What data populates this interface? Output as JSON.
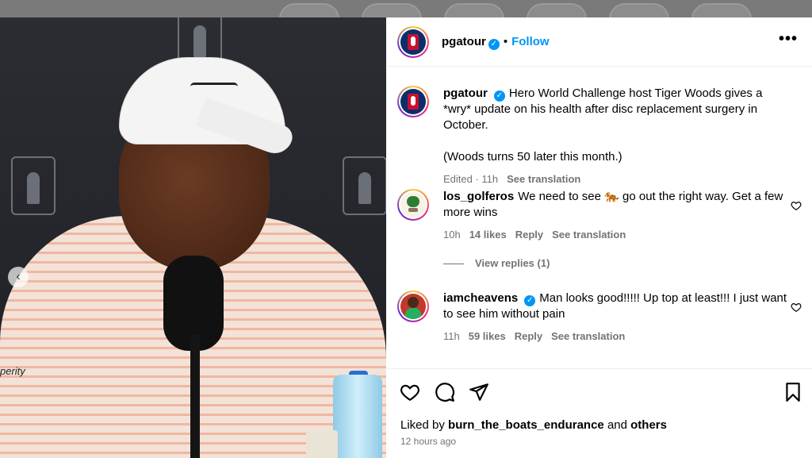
{
  "post": {
    "username": "pgatour",
    "follow_label": "Follow",
    "dot": "•",
    "more_label": "•••"
  },
  "photo": {
    "side_text": "perity",
    "carousel_prev": "‹"
  },
  "caption": {
    "username": "pgatour",
    "text_line1": "Hero World Challenge host Tiger Woods gives a *wry* update on his health after disc replacement surgery in October.",
    "text_line2": "(Woods turns 50 later this month.)",
    "edited": "Edited · 11h",
    "see_translation": "See translation"
  },
  "comments": [
    {
      "username": "los_golferos",
      "text": "We need to see 🐅 go out the right way. Get a few more wins",
      "time": "10h",
      "likes": "14 likes",
      "reply": "Reply",
      "see_translation": "See translation",
      "view_replies": "View replies (1)"
    },
    {
      "username": "iamcheavens",
      "text": "Man looks good!!!!! Up top at least!!! I just want to see him without pain",
      "time": "11h",
      "likes": "59 likes",
      "reply": "Reply",
      "see_translation": "See translation"
    }
  ],
  "footer": {
    "liked_by_prefix": "Liked by",
    "liked_by_user": "burn_the_boats_endurance",
    "liked_by_and": "and",
    "liked_by_others": "others",
    "time_ago": "12 hours ago"
  },
  "icons": {
    "verified": "verified-badge-icon",
    "heart": "heart-icon",
    "comment": "comment-icon",
    "share": "share-icon",
    "save": "bookmark-icon"
  },
  "colors": {
    "accent": "#0095f6",
    "secondary_text": "#737373"
  }
}
